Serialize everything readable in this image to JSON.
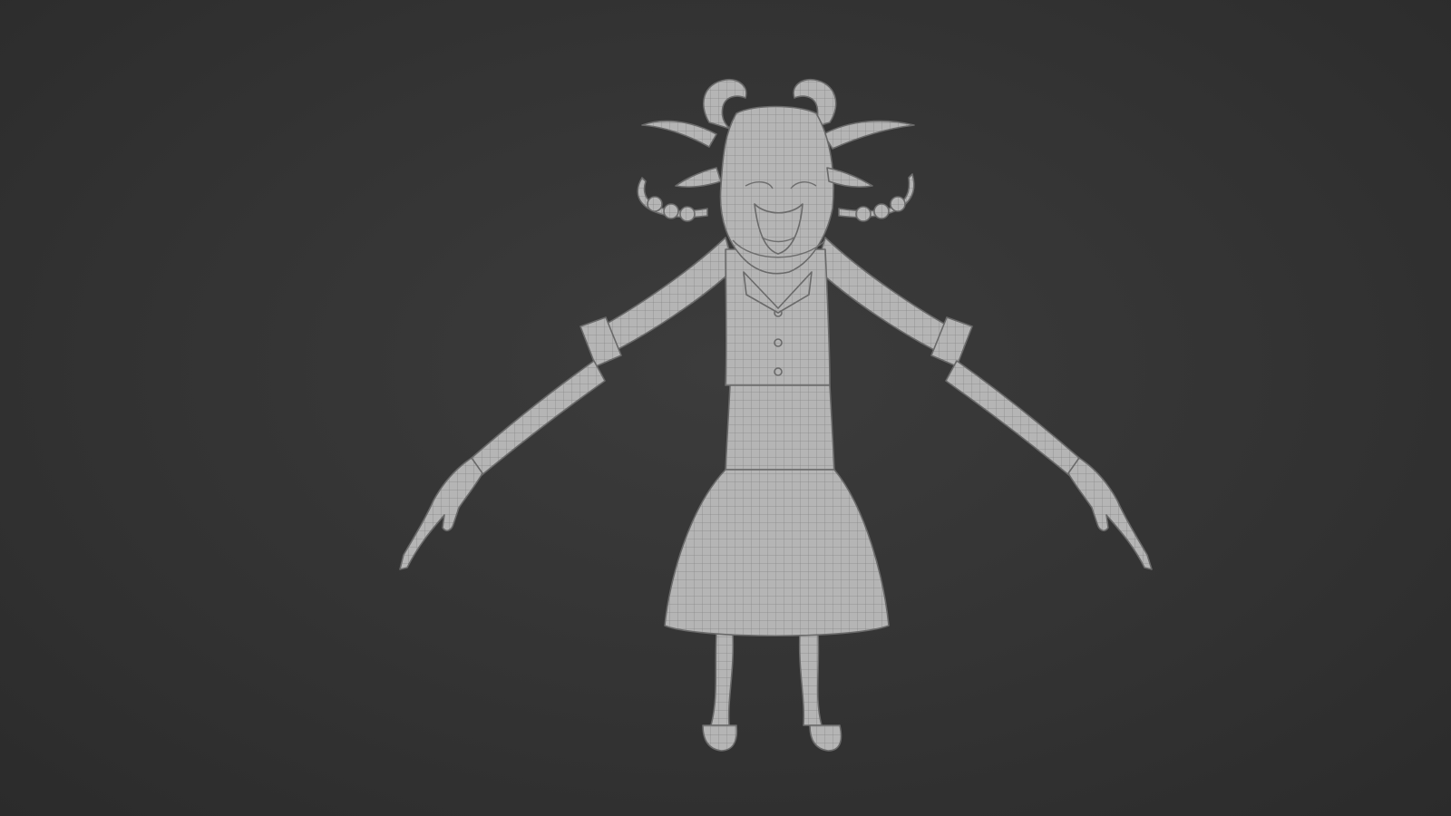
{
  "scene": {
    "subject": "wireframe-character-model",
    "colors": {
      "background": "#333333",
      "mesh_fill": "#b4b4b4",
      "wire": "#808080"
    }
  }
}
